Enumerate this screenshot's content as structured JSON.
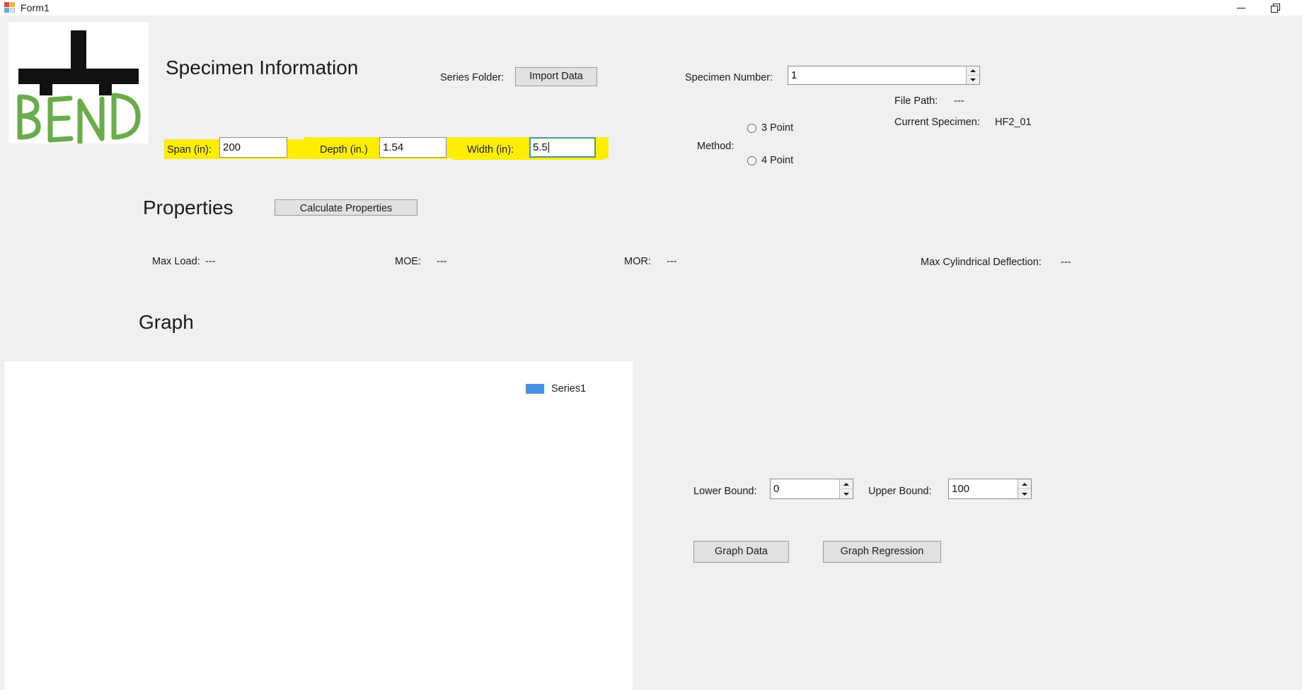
{
  "window": {
    "title": "Form1",
    "icon": "app-icon",
    "controls": {
      "minimize": "minimize-icon",
      "restore": "restore-icon",
      "close": "close-icon"
    }
  },
  "logo": {
    "text": "BEND",
    "green": "#6aab4c",
    "black": "#111111"
  },
  "specimen_section": {
    "heading": "Specimen Information",
    "series_folder_label": "Series Folder:",
    "import_button": "Import Data",
    "specimen_number_label": "Specimen Number:",
    "specimen_number_value": "1",
    "span_label": "Span (in):",
    "span_value": "200",
    "depth_label": "Depth (in.)",
    "depth_value": "1.54",
    "width_label": "Width (in):",
    "width_value": "5.5",
    "method_label": "Method:",
    "method_options": [
      "3 Point",
      "4 Point"
    ],
    "method_selected": "",
    "file_path_label": "File Path:",
    "file_path_value": "---",
    "current_specimen_label": "Current Specimen:",
    "current_specimen_value": "HF2_01",
    "highlight_color": "#fdee00"
  },
  "properties_section": {
    "heading": "Properties",
    "calculate_button": "Calculate Properties",
    "results": [
      {
        "label": "Max Load:",
        "value": "---"
      },
      {
        "label": "MOE:",
        "value": "---"
      },
      {
        "label": "MOR:",
        "value": "---"
      },
      {
        "label": "Max Cylindrical Deflection:",
        "value": "---"
      }
    ]
  },
  "graph_section": {
    "heading": "Graph",
    "legend_series": "Series1",
    "legend_color": "#4a90e2",
    "lower_bound_label": "Lower Bound:",
    "lower_bound_value": "0",
    "upper_bound_label": "Upper Bound:",
    "upper_bound_value": "100",
    "graph_data_button": "Graph Data",
    "graph_regression_button": "Graph Regression"
  }
}
